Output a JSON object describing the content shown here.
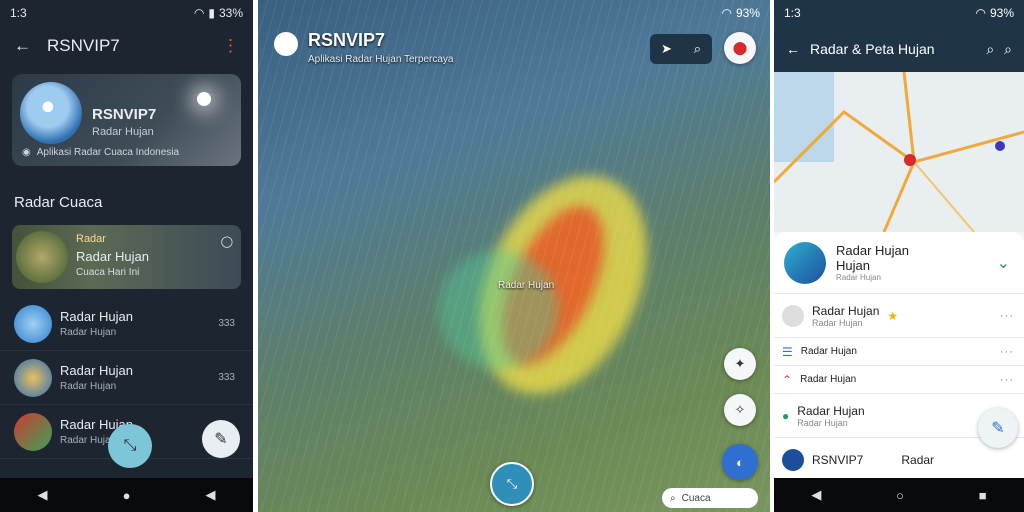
{
  "screen1": {
    "status": {
      "time": "1:3",
      "battery": "33%"
    },
    "appbar": {
      "title": "RSNVIP7"
    },
    "hero": {
      "title": "RSNVIP7",
      "subtitle": "Radar Hujan",
      "footer": "Aplikasi Radar Cuaca Indonesia"
    },
    "section_title": "Radar Cuaca",
    "card": {
      "line1": "Radar",
      "line2": "Radar Hujan",
      "line3": "Cuaca Hari Ini"
    },
    "list": [
      {
        "title": "Radar Hujan",
        "subtitle": "Radar Hujan",
        "trail": "333",
        "color": "#2f7fd0"
      },
      {
        "title": "Radar Hujan",
        "subtitle": "Radar Hujan",
        "trail": "333",
        "color": "#2d6cb8"
      },
      {
        "title": "Radar Hujan",
        "subtitle": "Radar Hujan",
        "trail": "",
        "color": "#3aa35a"
      }
    ]
  },
  "screen2": {
    "status": {
      "time": "",
      "battery": "93%"
    },
    "title": "RSNVIP7",
    "subtitle": "Aplikasi Radar Hujan Terpercaya",
    "labels": {
      "center": "Radar Hujan"
    },
    "search": "Cuaca"
  },
  "screen3": {
    "status": {
      "time": "1:3",
      "battery": "93%"
    },
    "appbar": {
      "title": "Radar & Peta Hujan"
    },
    "header": {
      "title": "Radar Hujan",
      "line2": "Hujan",
      "sub": "Radar Hujan"
    },
    "rows": [
      {
        "title": "Radar Hujan",
        "sub": "Radar Hujan"
      },
      {
        "title": "Radar Hujan",
        "sub": ""
      },
      {
        "title": "Radar Hujan",
        "sub": ""
      },
      {
        "title": "Radar Hujan",
        "sub": "Radar Hujan"
      },
      {
        "title": "RSNVIP7",
        "sub": "Radar"
      }
    ]
  },
  "colors": {
    "dark": "#1c2530",
    "accent": "#4aa8d8",
    "appbar3": "#1f3547"
  }
}
